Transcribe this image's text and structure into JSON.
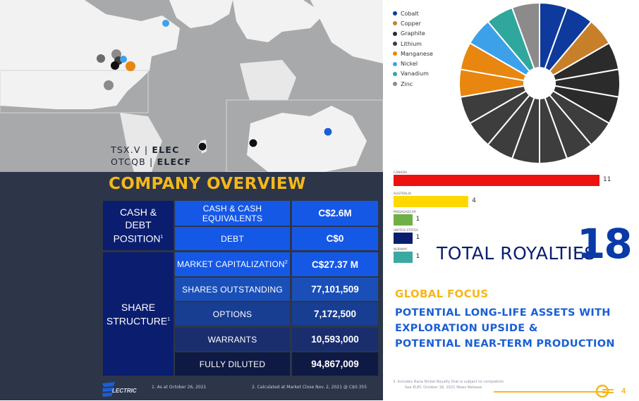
{
  "tickers": {
    "line1_prefix": "TSX.V | ",
    "line1_code": "ELEC",
    "line2_prefix": "OTCQB | ",
    "line2_code": "ELECF"
  },
  "overview": {
    "title": "COMPANY OVERVIEW",
    "groups": [
      {
        "label": "CASH & DEBT POSITION",
        "sup": "1"
      },
      {
        "label": "SHARE STRUCTURE",
        "sup": "1"
      }
    ],
    "rows": [
      {
        "label": "CASH & CASH EQUIVALENTS",
        "sup": "",
        "value": "C$2.6M"
      },
      {
        "label": "DEBT",
        "sup": "",
        "value": "C$0"
      },
      {
        "label": "MARKET CAPITALIZATION",
        "sup": "2",
        "value": "C$27.37 M"
      },
      {
        "label": "SHARES OUTSTANDING",
        "sup": "",
        "value": "77,101,509"
      },
      {
        "label": "OPTIONS",
        "sup": "",
        "value": "7,172,500"
      },
      {
        "label": "WARRANTS",
        "sup": "",
        "value": "10,593,000"
      },
      {
        "label": "FULLY DILUTED",
        "sup": "",
        "value": "94,867,009"
      }
    ],
    "logo_text": "LECTRIC",
    "footnote1": "1.    As at October 26, 2021",
    "footnote2": "2.    Calculated at Market Close Nov. 2, 2021 @ C$0.355"
  },
  "pie": {
    "legend": [
      {
        "label": "Cobalt",
        "color": "#0d3a9c"
      },
      {
        "label": "Copper",
        "color": "#c87f2a"
      },
      {
        "label": "Graphite",
        "color": "#2b2b2b"
      },
      {
        "label": "Lithium",
        "color": "#3d3d3d"
      },
      {
        "label": "Manganese",
        "color": "#e8860f"
      },
      {
        "label": "Nickel",
        "color": "#3da1ea"
      },
      {
        "label": "Vanadium",
        "color": "#2fa79c"
      },
      {
        "label": "Zinc",
        "color": "#8c8a8a"
      }
    ],
    "slices": [
      {
        "mineral": "Cobalt",
        "count": 2
      },
      {
        "mineral": "Copper",
        "count": 1
      },
      {
        "mineral": "Graphite",
        "count": 3
      },
      {
        "mineral": "Lithium",
        "count": 7
      },
      {
        "mineral": "Manganese",
        "count": 2
      },
      {
        "mineral": "Nickel",
        "count": 1
      },
      {
        "mineral": "Vanadium",
        "count": 1
      },
      {
        "mineral": "Zinc",
        "count": 1
      }
    ]
  },
  "bars": {
    "items": [
      {
        "label": "CANADA",
        "value": 11,
        "color": "#ee1111"
      },
      {
        "label": "AUSTRALIA",
        "value": 4,
        "color": "#ffd800"
      },
      {
        "label": "MADAGASCAR",
        "value": 1,
        "color": "#6fb044"
      },
      {
        "label": "UNITED STATES",
        "value": 1,
        "color": "#0a1d6e"
      },
      {
        "label": "NORWAY",
        "value": 1,
        "color": "#3aa9a0"
      }
    ]
  },
  "royalties": {
    "label": "TOTAL ROYALTIES",
    "sup": "3",
    "total": "18"
  },
  "focus": {
    "heading": "GLOBAL FOCUS",
    "lines": [
      "POTENTIAL LONG-LIFE ASSETS WITH",
      "EXPLORATION UPSIDE &",
      "POTENTIAL NEAR-TERM PRODUCTION"
    ]
  },
  "footer_right": {
    "note_line1": "3.    Includes Rana Nickel Royalty that is subject to completion.",
    "note_line2": "See ELEC October 18, 2021 News Release",
    "page": "4"
  }
}
